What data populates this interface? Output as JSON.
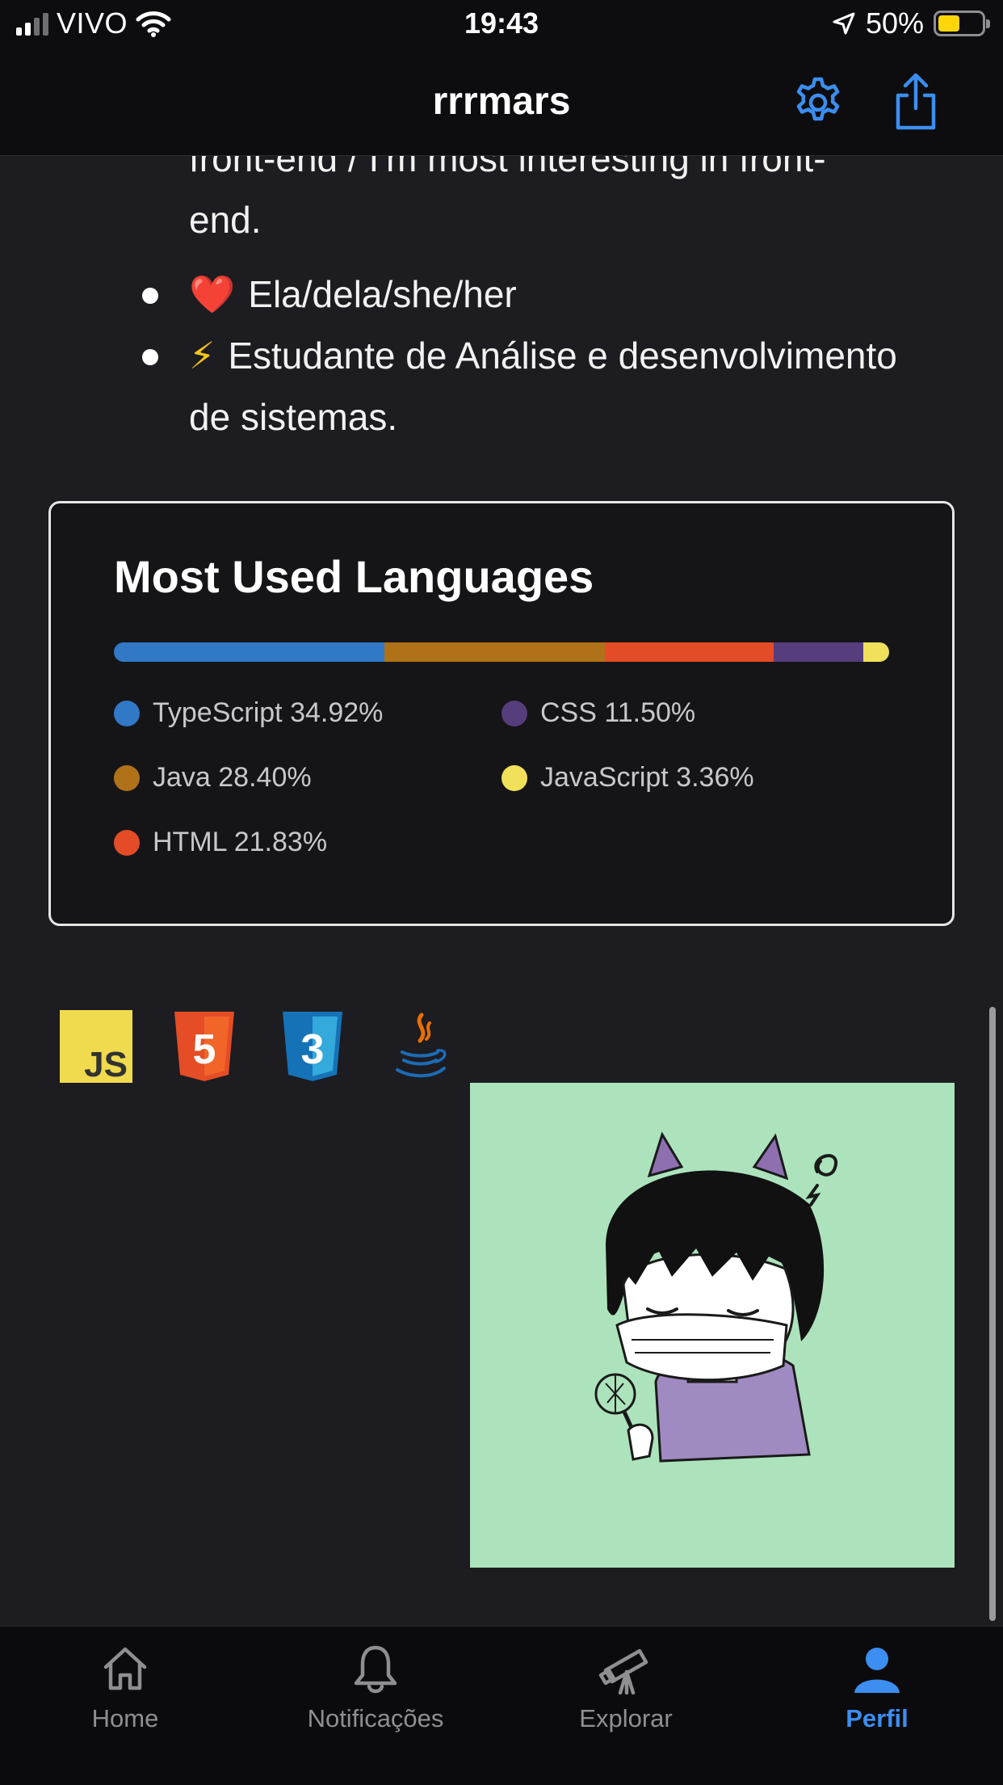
{
  "status_bar": {
    "carrier": "VIVO",
    "time": "19:43",
    "battery": "50%",
    "battery_level": 0.5,
    "battery_color": "#ffd60a"
  },
  "nav": {
    "title": "rrrmars",
    "icons": [
      "gear-icon",
      "share-icon"
    ],
    "accent": "#3c8ef0"
  },
  "bio": {
    "cut_line": "front-end / I'm most interesting in front-",
    "cut_line_end": "end.",
    "items": [
      {
        "emoji": "❤️",
        "text": "Ela/dela/she/her"
      },
      {
        "emoji": "⚡",
        "text": "Estudante de Análise e desenvolvimento de sistemas."
      }
    ]
  },
  "languages_card": {
    "title": "Most Used Languages",
    "languages": [
      {
        "name": "TypeScript",
        "percent": "34.92%",
        "value": 34.92,
        "color": "#3178c6"
      },
      {
        "name": "Java",
        "percent": "28.40%",
        "value": 28.4,
        "color": "#b07219"
      },
      {
        "name": "HTML",
        "percent": "21.83%",
        "value": 21.83,
        "color": "#e34c26"
      },
      {
        "name": "CSS",
        "percent": "11.50%",
        "value": 11.5,
        "color": "#563d7c"
      },
      {
        "name": "JavaScript",
        "percent": "3.36%",
        "value": 3.36,
        "color": "#f1e05a"
      }
    ]
  },
  "skills": {
    "icons": [
      "javascript-icon",
      "html5-icon",
      "css3-icon",
      "java-icon"
    ],
    "js_text": "JS",
    "html_text": "5",
    "css_text": "3"
  },
  "sticker": {
    "alt": "devil-girl-sticker",
    "background": "#ace3bc"
  },
  "tabs": [
    {
      "label": "Home",
      "icon": "home-icon",
      "active": false
    },
    {
      "label": "Notificações",
      "icon": "bell-icon",
      "active": false
    },
    {
      "label": "Explorar",
      "icon": "telescope-icon",
      "active": false
    },
    {
      "label": "Perfil",
      "icon": "person-icon",
      "active": true
    }
  ]
}
